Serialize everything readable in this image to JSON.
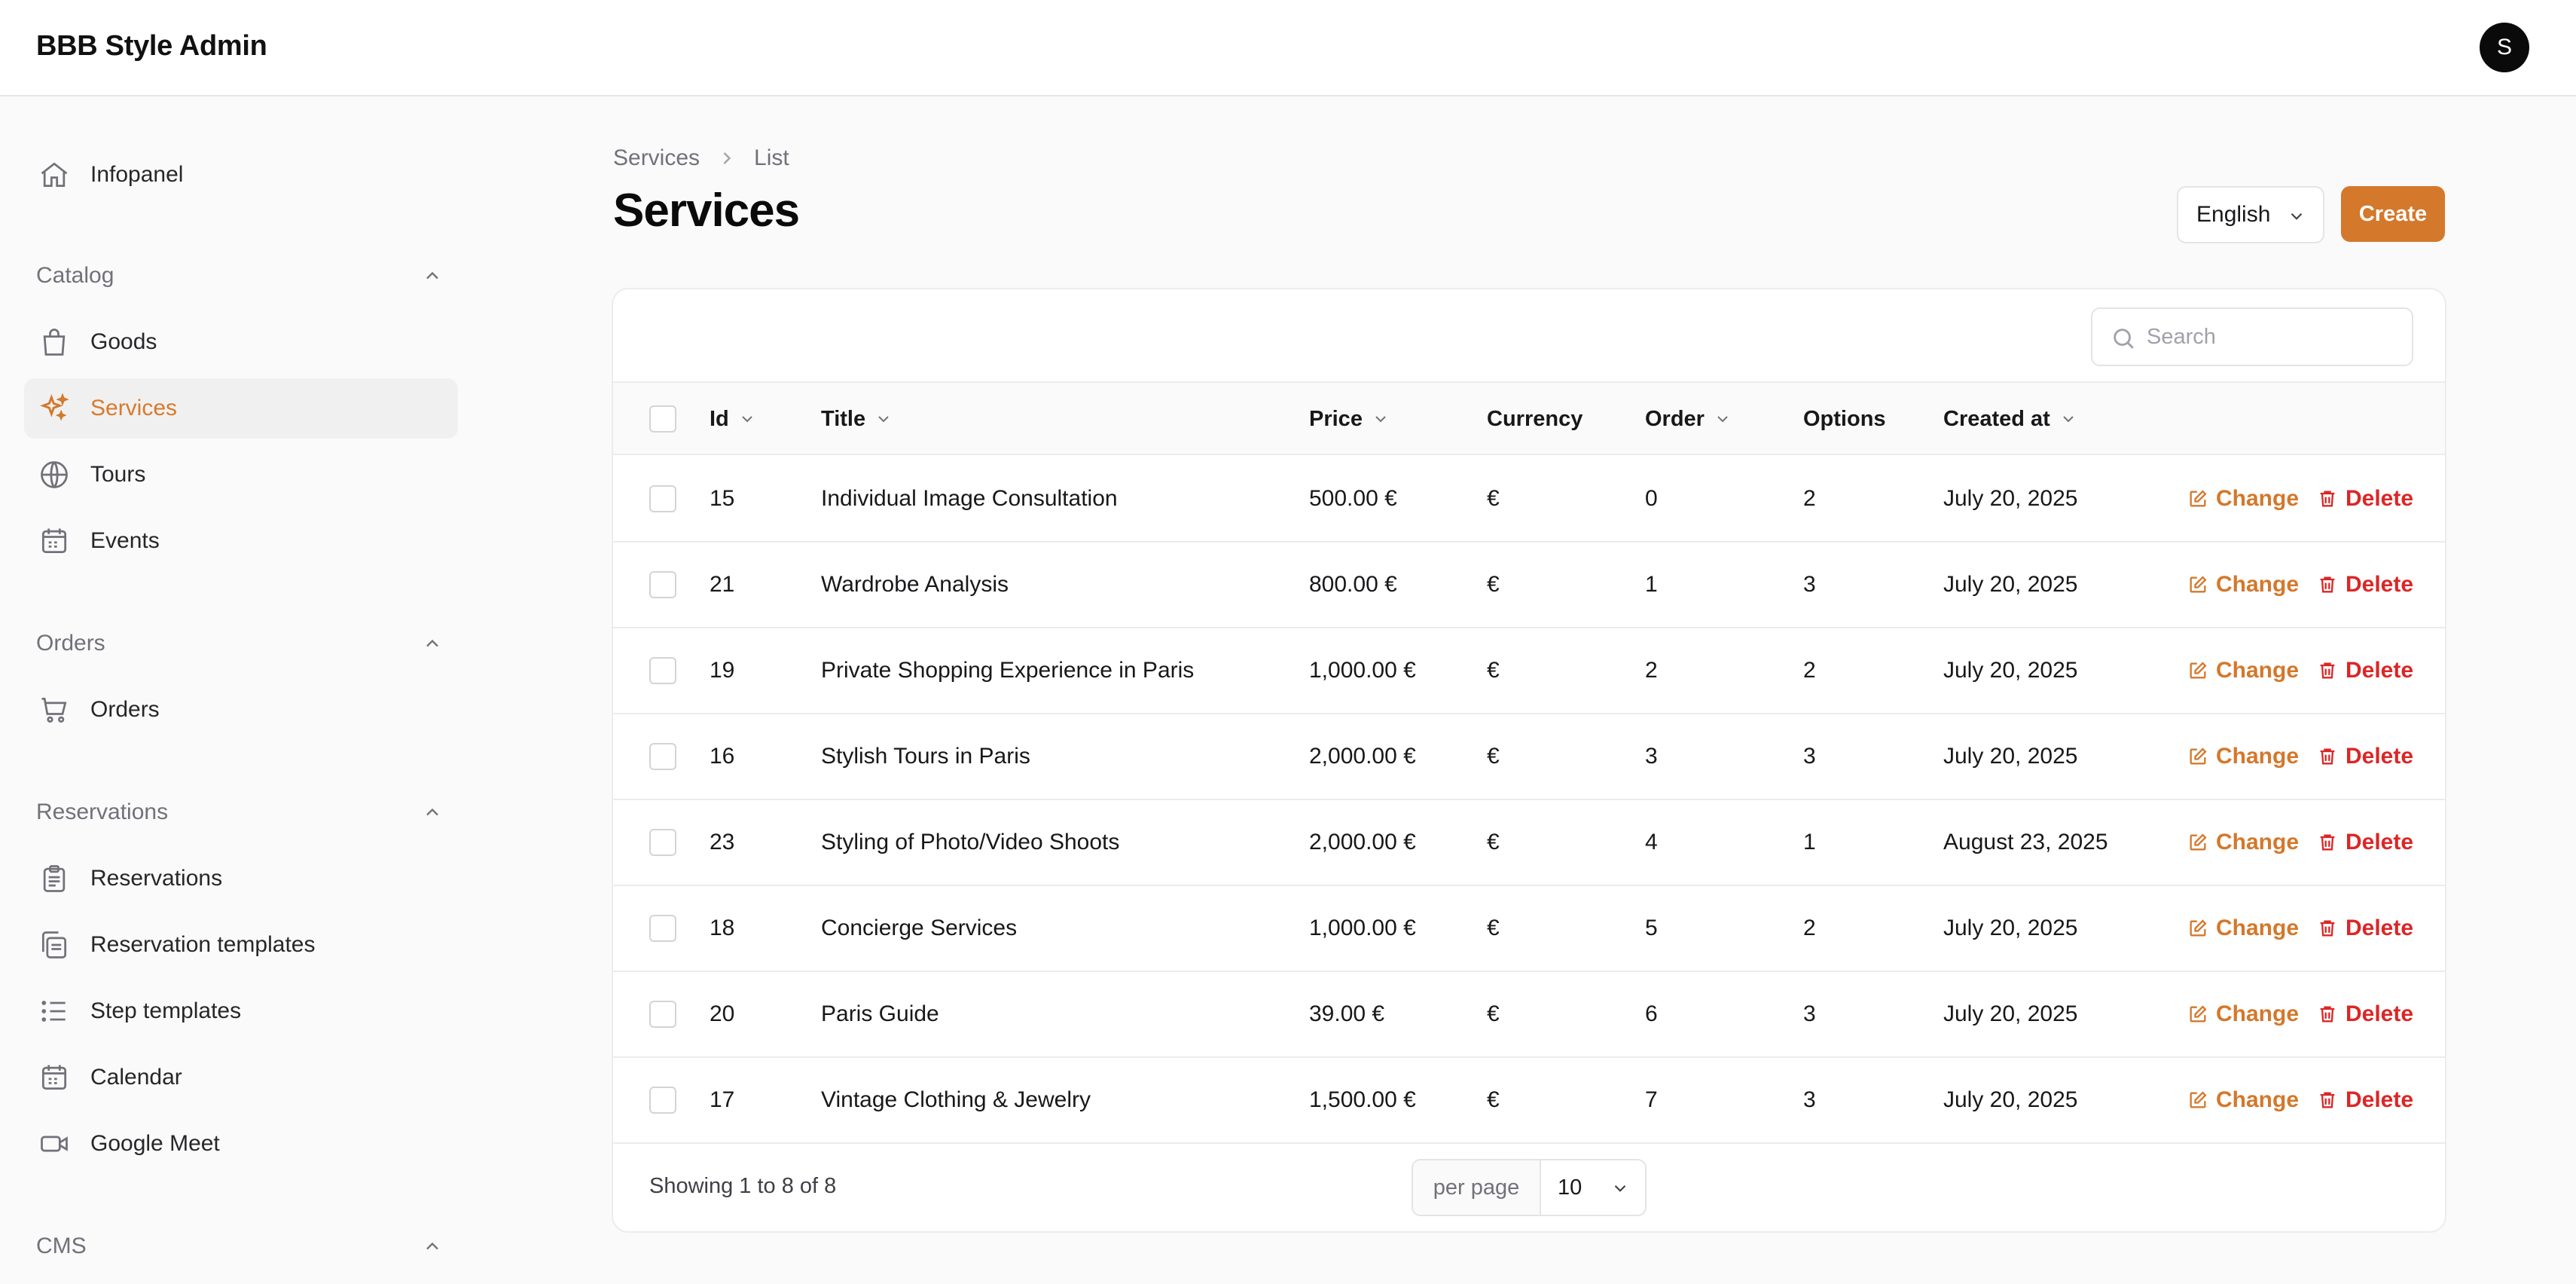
{
  "header": {
    "app_title": "BBB Style Admin",
    "avatar_initial": "S"
  },
  "sidebar": {
    "infopanel": {
      "label": "Infopanel",
      "icon": "home-icon"
    },
    "sections": [
      {
        "title": "Catalog",
        "items": [
          {
            "label": "Goods",
            "icon": "shopping-bag-icon"
          },
          {
            "label": "Services",
            "icon": "sparkles-icon",
            "active": true
          },
          {
            "label": "Tours",
            "icon": "globe-icon"
          },
          {
            "label": "Events",
            "icon": "calendar-icon"
          }
        ]
      },
      {
        "title": "Orders",
        "items": [
          {
            "label": "Orders",
            "icon": "cart-icon"
          }
        ]
      },
      {
        "title": "Reservations",
        "items": [
          {
            "label": "Reservations",
            "icon": "clipboard-icon"
          },
          {
            "label": "Reservation templates",
            "icon": "clipboard-copy-icon"
          },
          {
            "label": "Step templates",
            "icon": "list-icon"
          },
          {
            "label": "Calendar",
            "icon": "calendar-icon"
          },
          {
            "label": "Google Meet",
            "icon": "video-icon"
          }
        ]
      },
      {
        "title": "CMS",
        "items": []
      }
    ]
  },
  "breadcrumb": {
    "root": "Services",
    "current": "List"
  },
  "page": {
    "title": "Services"
  },
  "toolbar": {
    "language": "English",
    "create_label": "Create"
  },
  "search": {
    "placeholder": "Search"
  },
  "table": {
    "columns": {
      "id": "Id",
      "title": "Title",
      "price": "Price",
      "currency": "Currency",
      "order": "Order",
      "options": "Options",
      "created_at": "Created at"
    },
    "actions": {
      "change": "Change",
      "delete": "Delete"
    },
    "rows": [
      {
        "id": "15",
        "title": "Individual Image Consultation",
        "price": "500.00 €",
        "currency": "€",
        "order": "0",
        "options": "2",
        "created_at": "July 20, 2025"
      },
      {
        "id": "21",
        "title": "Wardrobe Analysis",
        "price": "800.00 €",
        "currency": "€",
        "order": "1",
        "options": "3",
        "created_at": "July 20, 2025"
      },
      {
        "id": "19",
        "title": "Private Shopping Experience in Paris",
        "price": "1,000.00 €",
        "currency": "€",
        "order": "2",
        "options": "2",
        "created_at": "July 20, 2025"
      },
      {
        "id": "16",
        "title": "Stylish Tours in Paris",
        "price": "2,000.00 €",
        "currency": "€",
        "order": "3",
        "options": "3",
        "created_at": "July 20, 2025"
      },
      {
        "id": "23",
        "title": "Styling of Photo/Video Shoots",
        "price": "2,000.00 €",
        "currency": "€",
        "order": "4",
        "options": "1",
        "created_at": "August 23, 2025"
      },
      {
        "id": "18",
        "title": "Concierge Services",
        "price": "1,000.00 €",
        "currency": "€",
        "order": "5",
        "options": "2",
        "created_at": "July 20, 2025"
      },
      {
        "id": "20",
        "title": "Paris Guide",
        "price": "39.00 €",
        "currency": "€",
        "order": "6",
        "options": "3",
        "created_at": "July 20, 2025"
      },
      {
        "id": "17",
        "title": "Vintage Clothing & Jewelry",
        "price": "1,500.00 €",
        "currency": "€",
        "order": "7",
        "options": "3",
        "created_at": "July 20, 2025"
      }
    ]
  },
  "footer": {
    "showing": "Showing 1 to 8 of 8",
    "per_page_label": "per page",
    "per_page_value": "10"
  },
  "colors": {
    "accent": "#d4782b",
    "danger": "#dc2626",
    "text": "#18181b",
    "muted": "#71717a"
  }
}
